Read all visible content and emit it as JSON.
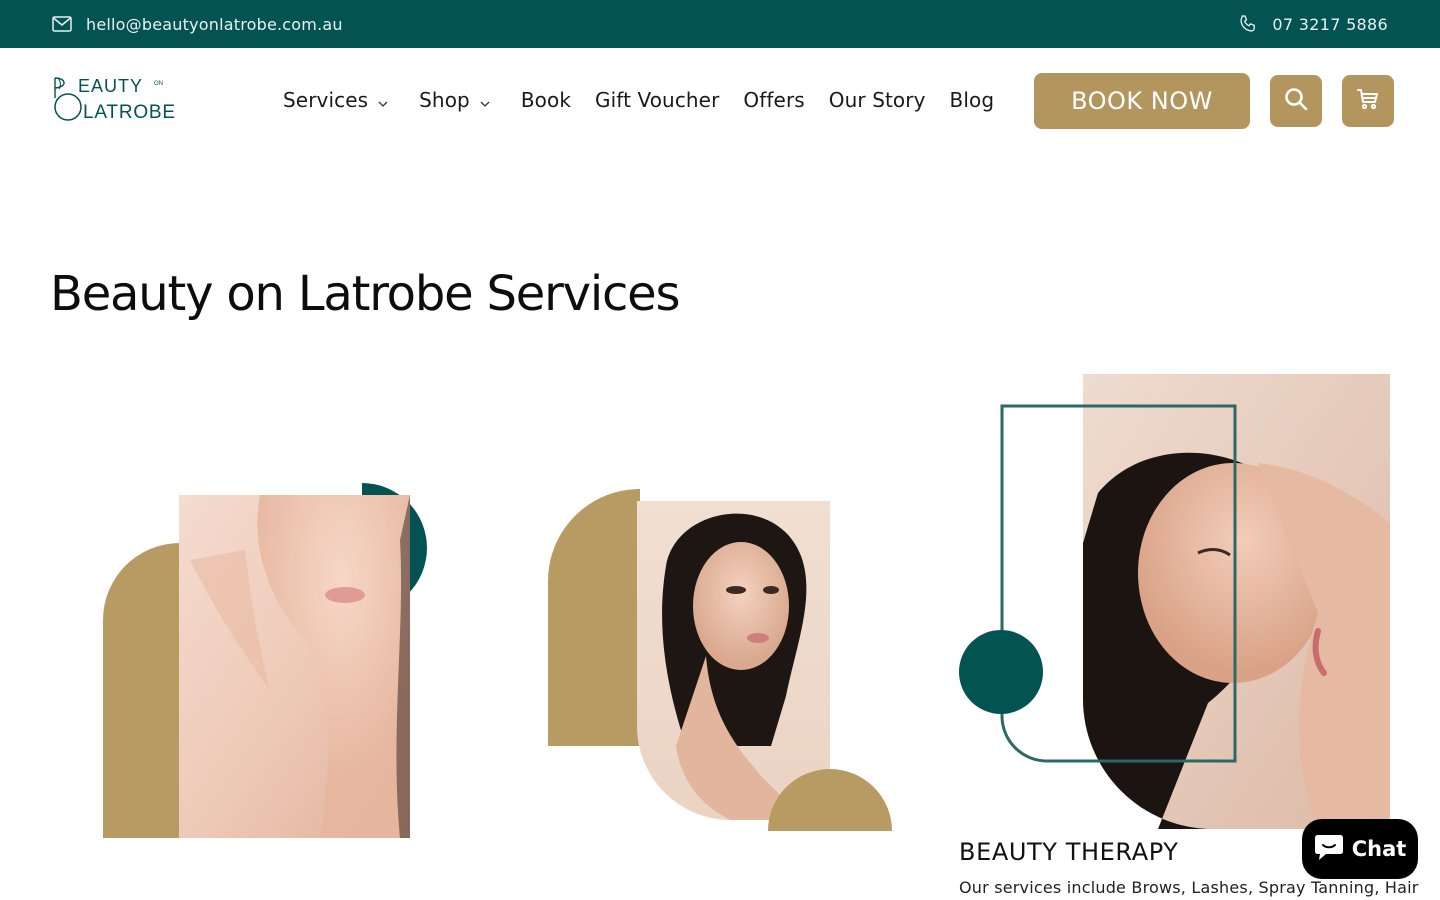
{
  "topbar": {
    "email": "hello@beautyonlatrobe.com.au",
    "email_icon": "mail-icon",
    "phone": "07 3217 5886",
    "phone_icon": "phone-icon",
    "bg_color": "#025352"
  },
  "logo": {
    "line1": "EAUTY",
    "small": "ON",
    "line2": "LATROBE",
    "alt": "Beauty on Latrobe logo"
  },
  "nav": {
    "items": [
      {
        "label": "Services",
        "has_dropdown": true
      },
      {
        "label": "Shop",
        "has_dropdown": true
      },
      {
        "label": "Book",
        "has_dropdown": false
      },
      {
        "label": "Gift Voucher",
        "has_dropdown": false
      },
      {
        "label": "Offers",
        "has_dropdown": false
      },
      {
        "label": "Our Story",
        "has_dropdown": false
      },
      {
        "label": "Blog",
        "has_dropdown": false
      }
    ]
  },
  "header": {
    "book_now_label": "BOOK NOW",
    "search_icon": "search-icon",
    "cart_icon": "cart-icon",
    "accent_color": "#b3955e"
  },
  "main": {
    "title": "Beauty on Latrobe Services",
    "cards": [
      {
        "title": "",
        "description": ""
      },
      {
        "title": "",
        "description": ""
      },
      {
        "title": "BEAUTY THERAPY",
        "description": "Our services include Brows, Lashes, Spray Tanning, Hair"
      }
    ]
  },
  "chat": {
    "label": "Chat",
    "icon": "chat-bubble-icon"
  }
}
